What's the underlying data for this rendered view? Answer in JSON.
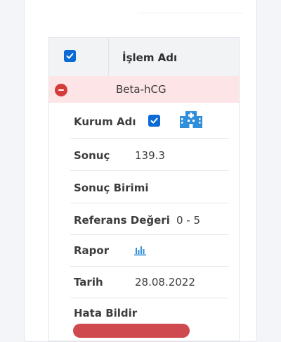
{
  "table": {
    "header_title": "İşlem Adı",
    "item_name": "Beta-hCG"
  },
  "details": {
    "kurum_label": "Kurum Adı",
    "sonuc_label": "Sonuç",
    "sonuc_value": "139.3",
    "birim_label": "Sonuç Birimi",
    "referans_label": "Referans Değeri",
    "referans_value": "0 - 5",
    "rapor_label": "Rapor",
    "tarih_label": "Tarih",
    "tarih_value": "28.08.2022",
    "hata_label": "Hata Bildir"
  },
  "icons": {
    "checkbox": "checkbox-checked-icon",
    "remove": "minus-circle-icon",
    "institution": "hospital-building-icon",
    "report": "bar-chart-icon"
  },
  "colors": {
    "accent_blue": "#0b6ad6",
    "icon_blue": "#2f8fdb",
    "danger_red": "#d43c3c",
    "selected_row_bg": "#fde4e7"
  }
}
